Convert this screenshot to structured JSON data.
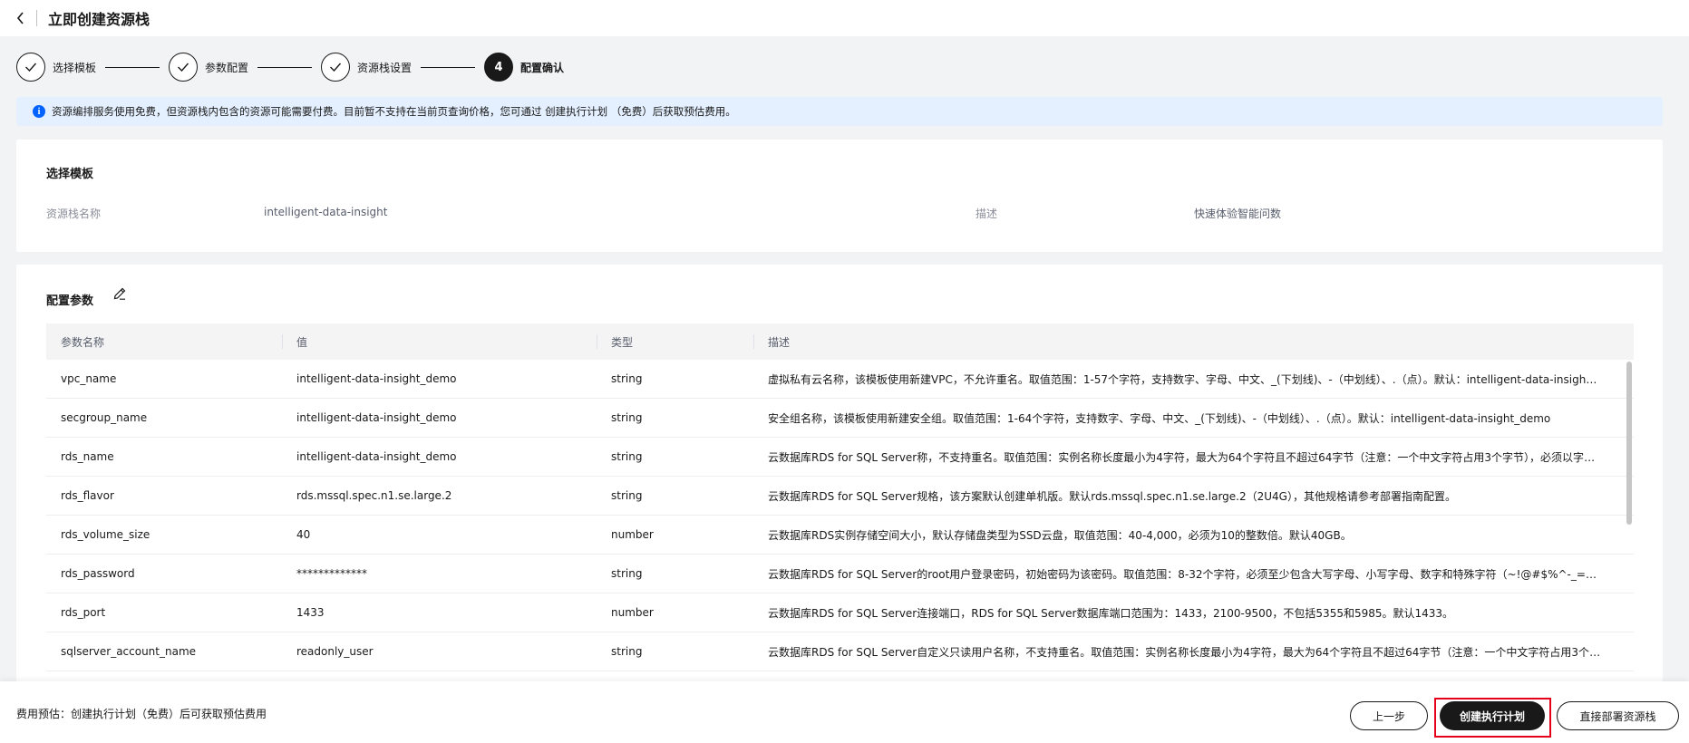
{
  "header": {
    "title": "立即创建资源栈"
  },
  "steps": [
    {
      "label": "选择模板",
      "state": "done"
    },
    {
      "label": "参数配置",
      "state": "done"
    },
    {
      "label": "资源栈设置",
      "state": "done"
    },
    {
      "label": "配置确认",
      "number": "4",
      "state": "active"
    }
  ],
  "info": {
    "text": "资源编排服务使用免费，但资源栈内包含的资源可能需要付费。目前暂不支持在当前页查询价格，您可通过 创建执行计划 （免费）后获取预估费用。"
  },
  "template_section": {
    "title": "选择模板",
    "name_label": "资源栈名称",
    "name_value": "intelligent-data-insight",
    "desc_label": "描述",
    "desc_value": "快速体验智能问数"
  },
  "params_section": {
    "title": "配置参数",
    "columns": [
      "参数名称",
      "值",
      "类型",
      "描述"
    ],
    "rows": [
      {
        "name": "vpc_name",
        "value": "intelligent-data-insight_demo",
        "type": "string",
        "desc": "虚拟私有云名称，该模板使用新建VPC，不允许重名。取值范围：1-57个字符，支持数字、字母、中文、_(下划线)、-（中划线）、.（点）。默认：intelligent-data-insight_d..."
      },
      {
        "name": "secgroup_name",
        "value": "intelligent-data-insight_demo",
        "type": "string",
        "desc": "安全组名称，该模板使用新建安全组。取值范围：1-64个字符，支持数字、字母、中文、_(下划线)、-（中划线）、.（点）。默认：intelligent-data-insight_demo"
      },
      {
        "name": "rds_name",
        "value": "intelligent-data-insight_demo",
        "type": "string",
        "desc": "云数据库RDS for SQL Server称，不支持重名。取值范围：实例名称长度最小为4字符，最大为64个字符且不超过64字节（注意：一个中文字符占用3个字节），必须以字母..."
      },
      {
        "name": "rds_flavor",
        "value": "rds.mssql.spec.n1.se.large.2",
        "type": "string",
        "desc": "云数据库RDS for SQL Server规格，该方案默认创建单机版。默认rds.mssql.spec.n1.se.large.2（2U4G），其他规格请参考部署指南配置。"
      },
      {
        "name": "rds_volume_size",
        "value": "40",
        "type": "number",
        "desc": "云数据库RDS实例存储空间大小，默认存储盘类型为SSD云盘，取值范围：40-4,000，必须为10的整数倍。默认40GB。"
      },
      {
        "name": "rds_password",
        "value": "*************",
        "type": "string",
        "desc": "云数据库RDS for SQL Server的root用户登录密码，初始密码为该密码。取值范围：8-32个字符，必须至少包含大写字母、小写字母、数字和特殊字符（~!@#$%^-_=+?,()&..."
      },
      {
        "name": "rds_port",
        "value": "1433",
        "type": "number",
        "desc": "云数据库RDS for SQL Server连接端口，RDS for SQL Server数据库端口范围为：1433，2100-9500，不包括5355和5985。默认1433。"
      },
      {
        "name": "sqlserver_account_name",
        "value": "readonly_user",
        "type": "string",
        "desc": "云数据库RDS for SQL Server自定义只读用户名称，不支持重名。取值范围：实例名称长度最小为4字符，最大为64个字符且不超过64字节（注意：一个中文字符占用3个字..."
      }
    ]
  },
  "footer": {
    "cost_text": "费用预估：创建执行计划（免费）后可获取预估费用",
    "prev_label": "上一步",
    "create_plan_label": "创建执行计划",
    "deploy_label": "直接部署资源栈"
  },
  "colors": {
    "primary": "#191919",
    "info_bg": "#e4f0ff",
    "info_icon": "#0062ff",
    "highlight": "#e6001a"
  },
  "icons": {
    "back": "chevron-left-icon",
    "check": "check-icon",
    "info": "info-icon",
    "edit": "edit-icon"
  }
}
